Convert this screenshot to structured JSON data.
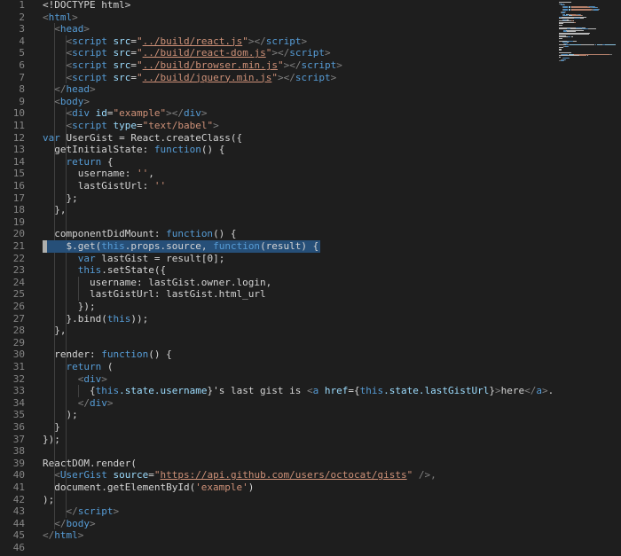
{
  "colors": {
    "background": "#1e1e1e",
    "line_number": "#858585",
    "text": "#d4d4d4",
    "tag": "#569cd6",
    "attribute": "#9cdcfe",
    "string": "#ce9178",
    "keyword": "#569cd6",
    "selection": "#264f78"
  },
  "editor": {
    "language": "html",
    "highlighted_line": 21,
    "lines": [
      {
        "n": "1",
        "tokens": [
          {
            "t": "<!DOCTYPE html>",
            "c": "pl"
          }
        ]
      },
      {
        "n": "2",
        "tokens": [
          {
            "t": "<",
            "c": "pu"
          },
          {
            "t": "html",
            "c": "tg"
          },
          {
            "t": ">",
            "c": "pu"
          }
        ]
      },
      {
        "n": "3",
        "tokens": [
          {
            "t": "  "
          },
          {
            "t": "<",
            "c": "pu"
          },
          {
            "t": "head",
            "c": "tg"
          },
          {
            "t": ">",
            "c": "pu"
          }
        ]
      },
      {
        "n": "4",
        "tokens": [
          {
            "t": "    "
          },
          {
            "t": "<",
            "c": "pu"
          },
          {
            "t": "script",
            "c": "tg"
          },
          {
            "t": " "
          },
          {
            "t": "src",
            "c": "at"
          },
          {
            "t": "=",
            "c": "pl"
          },
          {
            "t": "\"",
            "c": "st"
          },
          {
            "t": "../build/react.js",
            "c": "st",
            "u": true
          },
          {
            "t": "\"",
            "c": "st"
          },
          {
            "t": "></",
            "c": "pu"
          },
          {
            "t": "script",
            "c": "tg"
          },
          {
            "t": ">",
            "c": "pu"
          }
        ]
      },
      {
        "n": "5",
        "tokens": [
          {
            "t": "    "
          },
          {
            "t": "<",
            "c": "pu"
          },
          {
            "t": "script",
            "c": "tg"
          },
          {
            "t": " "
          },
          {
            "t": "src",
            "c": "at"
          },
          {
            "t": "=",
            "c": "pl"
          },
          {
            "t": "\"",
            "c": "st"
          },
          {
            "t": "../build/react-dom.js",
            "c": "st",
            "u": true
          },
          {
            "t": "\"",
            "c": "st"
          },
          {
            "t": "></",
            "c": "pu"
          },
          {
            "t": "script",
            "c": "tg"
          },
          {
            "t": ">",
            "c": "pu"
          }
        ]
      },
      {
        "n": "6",
        "tokens": [
          {
            "t": "    "
          },
          {
            "t": "<",
            "c": "pu"
          },
          {
            "t": "script",
            "c": "tg"
          },
          {
            "t": " "
          },
          {
            "t": "src",
            "c": "at"
          },
          {
            "t": "=",
            "c": "pl"
          },
          {
            "t": "\"",
            "c": "st"
          },
          {
            "t": "../build/browser.min.js",
            "c": "st",
            "u": true
          },
          {
            "t": "\"",
            "c": "st"
          },
          {
            "t": "></",
            "c": "pu"
          },
          {
            "t": "script",
            "c": "tg"
          },
          {
            "t": ">",
            "c": "pu"
          }
        ]
      },
      {
        "n": "7",
        "tokens": [
          {
            "t": "    "
          },
          {
            "t": "<",
            "c": "pu"
          },
          {
            "t": "script",
            "c": "tg"
          },
          {
            "t": " "
          },
          {
            "t": "src",
            "c": "at"
          },
          {
            "t": "=",
            "c": "pl"
          },
          {
            "t": "\"",
            "c": "st"
          },
          {
            "t": "../build/jquery.min.js",
            "c": "st",
            "u": true
          },
          {
            "t": "\"",
            "c": "st"
          },
          {
            "t": "></",
            "c": "pu"
          },
          {
            "t": "script",
            "c": "tg"
          },
          {
            "t": ">",
            "c": "pu"
          }
        ]
      },
      {
        "n": "8",
        "tokens": [
          {
            "t": "  "
          },
          {
            "t": "</",
            "c": "pu"
          },
          {
            "t": "head",
            "c": "tg"
          },
          {
            "t": ">",
            "c": "pu"
          }
        ]
      },
      {
        "n": "9",
        "tokens": [
          {
            "t": "  "
          },
          {
            "t": "<",
            "c": "pu"
          },
          {
            "t": "body",
            "c": "tg"
          },
          {
            "t": ">",
            "c": "pu"
          }
        ]
      },
      {
        "n": "10",
        "tokens": [
          {
            "t": "    "
          },
          {
            "t": "<",
            "c": "pu"
          },
          {
            "t": "div",
            "c": "tg"
          },
          {
            "t": " "
          },
          {
            "t": "id",
            "c": "at"
          },
          {
            "t": "=",
            "c": "pl"
          },
          {
            "t": "\"example\"",
            "c": "st"
          },
          {
            "t": "></",
            "c": "pu"
          },
          {
            "t": "div",
            "c": "tg"
          },
          {
            "t": ">",
            "c": "pu"
          }
        ]
      },
      {
        "n": "11",
        "tokens": [
          {
            "t": "    "
          },
          {
            "t": "<",
            "c": "pu"
          },
          {
            "t": "script",
            "c": "tg"
          },
          {
            "t": " "
          },
          {
            "t": "type",
            "c": "at"
          },
          {
            "t": "=",
            "c": "pl"
          },
          {
            "t": "\"text/babel\"",
            "c": "st"
          },
          {
            "t": ">",
            "c": "pu"
          }
        ]
      },
      {
        "n": "12",
        "tokens": [
          {
            "t": "var",
            "c": "kw"
          },
          {
            "t": " UserGist = React.createClass({",
            "c": "pl"
          }
        ]
      },
      {
        "n": "13",
        "tokens": [
          {
            "t": "  getInitialState: ",
            "c": "pl"
          },
          {
            "t": "function",
            "c": "kw"
          },
          {
            "t": "() {",
            "c": "pl"
          }
        ]
      },
      {
        "n": "14",
        "tokens": [
          {
            "t": "    "
          },
          {
            "t": "return",
            "c": "kw"
          },
          {
            "t": " {",
            "c": "pl"
          }
        ]
      },
      {
        "n": "15",
        "tokens": [
          {
            "t": "      username: ",
            "c": "pl"
          },
          {
            "t": "''",
            "c": "st"
          },
          {
            "t": ",",
            "c": "pl"
          }
        ]
      },
      {
        "n": "16",
        "tokens": [
          {
            "t": "      lastGistUrl: ",
            "c": "pl"
          },
          {
            "t": "''",
            "c": "st"
          }
        ]
      },
      {
        "n": "17",
        "tokens": [
          {
            "t": "    };",
            "c": "pl"
          }
        ]
      },
      {
        "n": "18",
        "tokens": [
          {
            "t": "  },",
            "c": "pl"
          }
        ]
      },
      {
        "n": "19",
        "tokens": []
      },
      {
        "n": "20",
        "tokens": [
          {
            "t": "  componentDidMount: ",
            "c": "pl"
          },
          {
            "t": "function",
            "c": "kw"
          },
          {
            "t": "() {",
            "c": "pl"
          }
        ]
      },
      {
        "n": "21",
        "tokens": [
          {
            "t": "    $.get(",
            "c": "pl"
          },
          {
            "t": "this",
            "c": "kw"
          },
          {
            "t": ".props.source, ",
            "c": "pl"
          },
          {
            "t": "function",
            "c": "kw"
          },
          {
            "t": "(result) {",
            "c": "pl"
          }
        ]
      },
      {
        "n": "22",
        "tokens": [
          {
            "t": "      "
          },
          {
            "t": "var",
            "c": "kw"
          },
          {
            "t": " lastGist = result[0];",
            "c": "pl"
          }
        ]
      },
      {
        "n": "23",
        "tokens": [
          {
            "t": "      "
          },
          {
            "t": "this",
            "c": "kw"
          },
          {
            "t": ".setState({",
            "c": "pl"
          }
        ]
      },
      {
        "n": "24",
        "tokens": [
          {
            "t": "        username: lastGist.owner.login,",
            "c": "pl"
          }
        ]
      },
      {
        "n": "25",
        "tokens": [
          {
            "t": "        lastGistUrl: lastGist.html_url",
            "c": "pl"
          }
        ]
      },
      {
        "n": "26",
        "tokens": [
          {
            "t": "      });",
            "c": "pl"
          }
        ]
      },
      {
        "n": "27",
        "tokens": [
          {
            "t": "    }.bind(",
            "c": "pl"
          },
          {
            "t": "this",
            "c": "kw"
          },
          {
            "t": "));",
            "c": "pl"
          }
        ]
      },
      {
        "n": "28",
        "tokens": [
          {
            "t": "  },",
            "c": "pl"
          }
        ]
      },
      {
        "n": "29",
        "tokens": []
      },
      {
        "n": "30",
        "tokens": [
          {
            "t": "  render: ",
            "c": "pl"
          },
          {
            "t": "function",
            "c": "kw"
          },
          {
            "t": "() {",
            "c": "pl"
          }
        ]
      },
      {
        "n": "31",
        "tokens": [
          {
            "t": "    "
          },
          {
            "t": "return",
            "c": "kw"
          },
          {
            "t": " (",
            "c": "pl"
          }
        ]
      },
      {
        "n": "32",
        "tokens": [
          {
            "t": "      "
          },
          {
            "t": "<",
            "c": "pu"
          },
          {
            "t": "div",
            "c": "tg"
          },
          {
            "t": ">",
            "c": "pu"
          }
        ]
      },
      {
        "n": "33",
        "tokens": [
          {
            "t": "        {",
            "c": "pl"
          },
          {
            "t": "this",
            "c": "kw"
          },
          {
            "t": ".state.username",
            "c": "at"
          },
          {
            "t": "}'s last gist is ",
            "c": "pl"
          },
          {
            "t": "<",
            "c": "pu"
          },
          {
            "t": "a",
            "c": "tg"
          },
          {
            "t": " "
          },
          {
            "t": "href",
            "c": "at"
          },
          {
            "t": "={",
            "c": "pl"
          },
          {
            "t": "this",
            "c": "kw"
          },
          {
            "t": ".state.lastGistUrl",
            "c": "at"
          },
          {
            "t": "}",
            "c": "pl"
          },
          {
            "t": ">",
            "c": "pu"
          },
          {
            "t": "here",
            "c": "pl"
          },
          {
            "t": "</",
            "c": "pu"
          },
          {
            "t": "a",
            "c": "tg"
          },
          {
            "t": ">",
            "c": "pu"
          },
          {
            "t": ".",
            "c": "pl"
          }
        ]
      },
      {
        "n": "34",
        "tokens": [
          {
            "t": "      "
          },
          {
            "t": "</",
            "c": "pu"
          },
          {
            "t": "div",
            "c": "tg"
          },
          {
            "t": ">",
            "c": "pu"
          }
        ]
      },
      {
        "n": "35",
        "tokens": [
          {
            "t": "    );",
            "c": "pl"
          }
        ]
      },
      {
        "n": "36",
        "tokens": [
          {
            "t": "  }",
            "c": "pl"
          }
        ]
      },
      {
        "n": "37",
        "tokens": [
          {
            "t": "});",
            "c": "pl"
          }
        ]
      },
      {
        "n": "38",
        "tokens": []
      },
      {
        "n": "39",
        "tokens": [
          {
            "t": "ReactDOM.render(",
            "c": "pl"
          }
        ]
      },
      {
        "n": "40",
        "tokens": [
          {
            "t": "  "
          },
          {
            "t": "<",
            "c": "pu"
          },
          {
            "t": "UserGist",
            "c": "tg"
          },
          {
            "t": " "
          },
          {
            "t": "source",
            "c": "at"
          },
          {
            "t": "=",
            "c": "pl"
          },
          {
            "t": "\"",
            "c": "st"
          },
          {
            "t": "https://api.github.com/users/octocat/gists",
            "c": "st",
            "u": true
          },
          {
            "t": "\"",
            "c": "st"
          },
          {
            "t": " />,",
            "c": "pu"
          }
        ]
      },
      {
        "n": "41",
        "tokens": [
          {
            "t": "  document.getElementById(",
            "c": "pl"
          },
          {
            "t": "'example'",
            "c": "st"
          },
          {
            "t": ")",
            "c": "pl"
          }
        ]
      },
      {
        "n": "42",
        "tokens": [
          {
            "t": ");",
            "c": "pl"
          }
        ]
      },
      {
        "n": "43",
        "tokens": [
          {
            "t": "    "
          },
          {
            "t": "</",
            "c": "pu"
          },
          {
            "t": "script",
            "c": "tg"
          },
          {
            "t": ">",
            "c": "pu"
          }
        ]
      },
      {
        "n": "44",
        "tokens": [
          {
            "t": "  "
          },
          {
            "t": "</",
            "c": "pu"
          },
          {
            "t": "body",
            "c": "tg"
          },
          {
            "t": ">",
            "c": "pu"
          }
        ]
      },
      {
        "n": "45",
        "tokens": [
          {
            "t": "</",
            "c": "pu"
          },
          {
            "t": "html",
            "c": "tg"
          },
          {
            "t": ">",
            "c": "pu"
          }
        ]
      },
      {
        "n": "46",
        "tokens": []
      }
    ]
  }
}
